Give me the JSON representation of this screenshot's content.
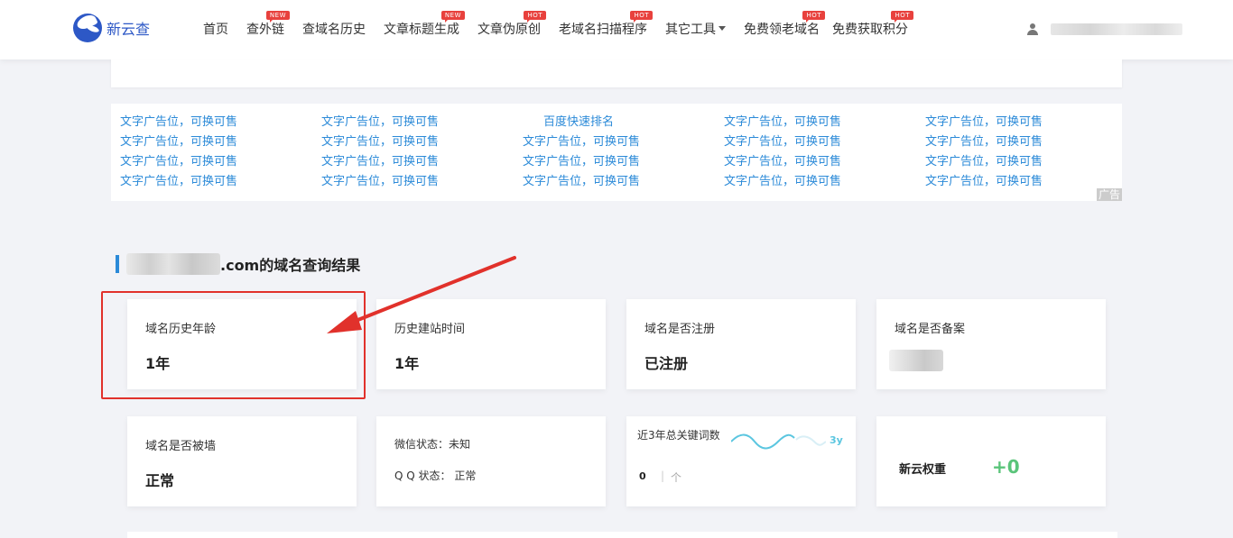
{
  "logo": {
    "text": "新云查"
  },
  "nav": [
    {
      "label": "首页",
      "badge": ""
    },
    {
      "label": "查外链",
      "badge": "NEW"
    },
    {
      "label": "查域名历史",
      "badge": ""
    },
    {
      "label": "文章标题生成",
      "badge": "NEW"
    },
    {
      "label": "文章伪原创",
      "badge": "HOT"
    },
    {
      "label": "老域名扫描程序",
      "badge": "HOT"
    },
    {
      "label": "其它工具",
      "badge": ""
    },
    {
      "label": "免费领老域名",
      "badge": "HOT"
    },
    {
      "label": "免费获取积分",
      "badge": "HOT"
    }
  ],
  "ads": {
    "rows": [
      [
        "文字广告位，可换可售",
        "文字广告位，可换可售",
        "百度快速排名",
        "文字广告位，可换可售",
        "文字广告位，可换可售"
      ],
      [
        "文字广告位，可换可售",
        "文字广告位，可换可售",
        "文字广告位，可换可售",
        "文字广告位，可换可售",
        "文字广告位，可换可售"
      ],
      [
        "文字广告位，可换可售",
        "文字广告位，可换可售",
        "文字广告位，可换可售",
        "文字广告位，可换可售",
        "文字广告位，可换可售"
      ],
      [
        "文字广告位，可换可售",
        "文字广告位，可换可售",
        "文字广告位，可换可售",
        "文字广告位，可换可售",
        "文字广告位，可换可售"
      ]
    ],
    "tag": "广告"
  },
  "result": {
    "title_suffix": ".com的域名查询结果"
  },
  "cards": {
    "age": {
      "label": "域名历史年龄",
      "value": "1年"
    },
    "build_time": {
      "label": "历史建站时间",
      "value": "1年"
    },
    "registered": {
      "label": "域名是否注册",
      "value": "已注册"
    },
    "beian": {
      "label": "域名是否备案"
    },
    "blocked": {
      "label": "域名是否被墙",
      "value": "正常"
    },
    "wechat": {
      "wx": "微信状态：未知",
      "qq": "Q Q 状态：  正常"
    },
    "keywords": {
      "label": "近3年总关键词数",
      "tag": "3y",
      "count": "0",
      "sep": "|",
      "unit": "个"
    },
    "weight": {
      "label": "新云权重",
      "value": "+0"
    }
  },
  "colors": {
    "brand": "#2d58c6",
    "link": "#2b8ad8",
    "badge": "#e8413d",
    "highlight": "#e1312b",
    "weight": "#5ac47a"
  }
}
